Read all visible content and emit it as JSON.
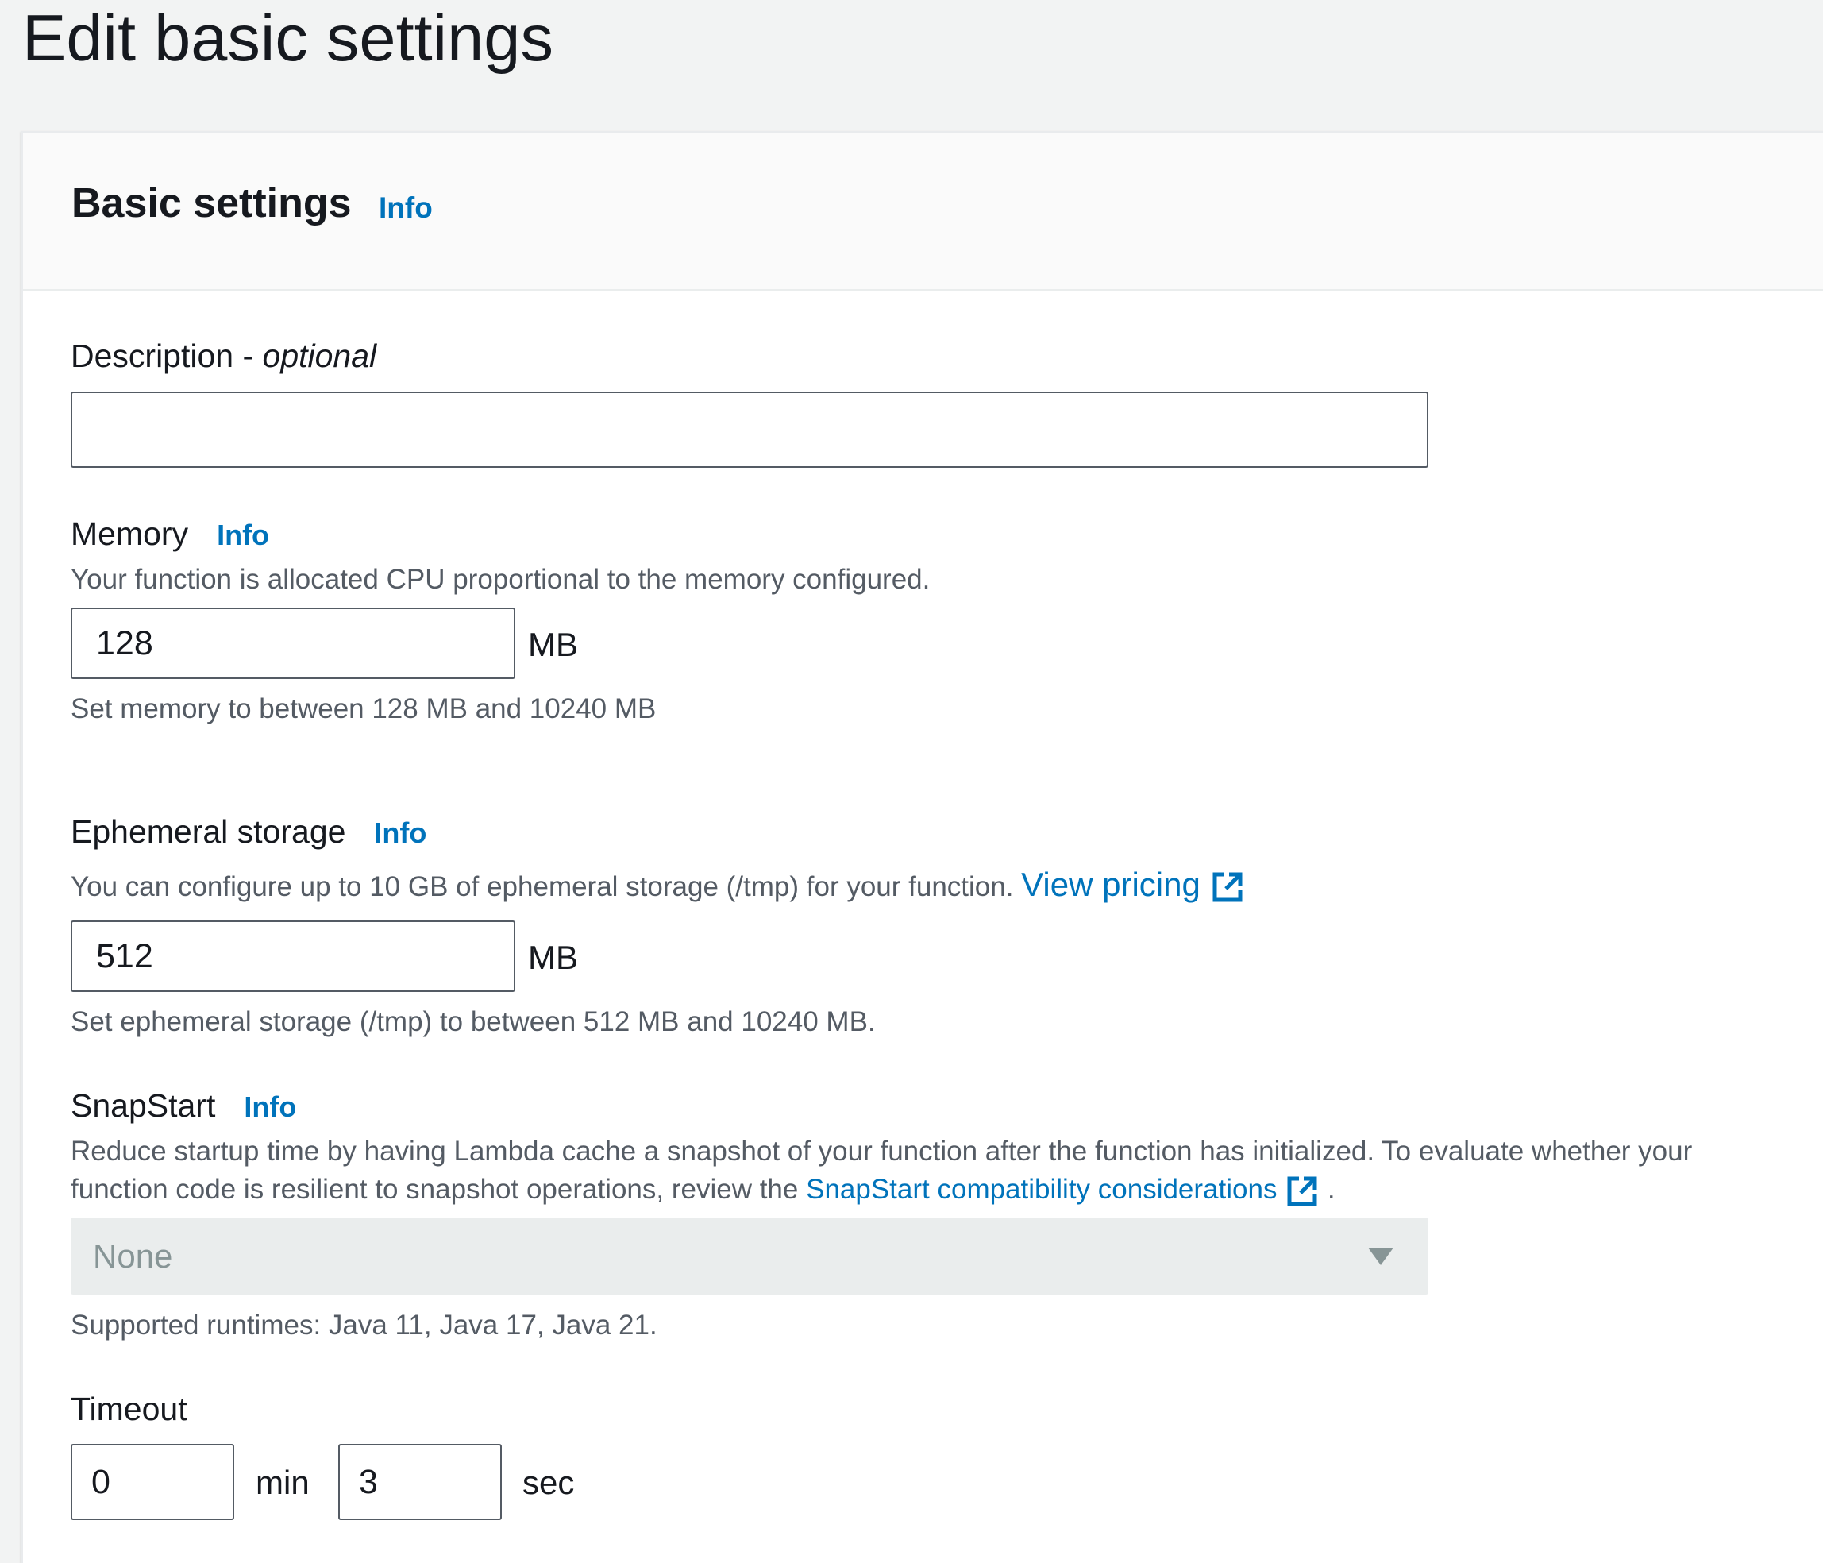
{
  "page": {
    "title": "Edit basic settings"
  },
  "panel": {
    "title": "Basic settings",
    "info": "Info"
  },
  "description": {
    "label": "Description - ",
    "label_optional": "optional",
    "value": "",
    "placeholder": ""
  },
  "memory": {
    "label": "Memory",
    "info": "Info",
    "description": "Your function is allocated CPU proportional to the memory configured.",
    "value": "128",
    "unit": "MB",
    "hint": "Set memory to between 128 MB and 10240 MB"
  },
  "ephemeral_storage": {
    "label": "Ephemeral storage",
    "info": "Info",
    "description": "You can configure up to 10 GB of ephemeral storage (/tmp) for your function. ",
    "link": "View pricing",
    "link_icon": "external-link-icon",
    "value": "512",
    "unit": "MB",
    "hint": "Set ephemeral storage (/tmp) to between 512 MB and 10240 MB."
  },
  "snapstart": {
    "label": "SnapStart",
    "info": "Info",
    "description_line1": "Reduce startup time by having Lambda cache a snapshot of your function after the function has initialized. To evaluate whether your",
    "description_line2": "function code is resilient to snapshot operations, review the ",
    "link": "SnapStart compatibility considerations",
    "link_icon": "external-link-icon",
    "description_end": ".",
    "select_value": "None",
    "select_icon": "caret-down-icon",
    "hint": "Supported runtimes: Java 11, Java 17, Java 21."
  },
  "timeout": {
    "label": "Timeout",
    "min_value": "0",
    "min_unit": "min",
    "sec_value": "3",
    "sec_unit": "sec"
  },
  "colors": {
    "link": "#0073bb",
    "text": "#16191f",
    "secondary_text": "#545b64",
    "page_background": "#f2f3f3",
    "disabled_select": "#eaeded"
  }
}
